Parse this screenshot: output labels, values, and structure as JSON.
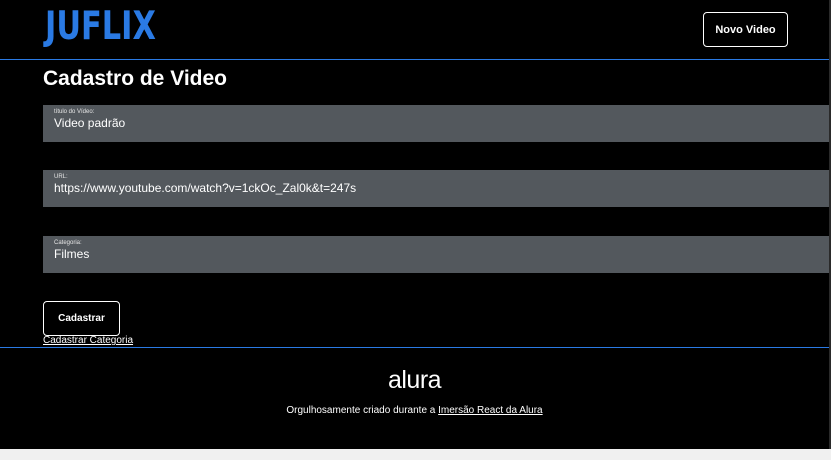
{
  "header": {
    "logo": "JUFLIX",
    "new_video_label": "Novo Video"
  },
  "form": {
    "title": "Cadastro de Video",
    "fields": [
      {
        "label": "título do Vídeo:",
        "value": "Video padrão"
      },
      {
        "label": "URL:",
        "value": "https://www.youtube.com/watch?v=1ckOc_Zal0k&t=247s"
      },
      {
        "label": "Categoria:",
        "value": "Filmes"
      }
    ],
    "submit_label": "Cadastrar",
    "category_link": "Cadastrar Categoria"
  },
  "footer": {
    "brand": "alura",
    "text_prefix": "Orgulhosamente criado durante a ",
    "link_text": "Imersão React da Alura"
  },
  "colors": {
    "accent": "#2a7ae4",
    "field_bg": "#53585d",
    "background": "#000000"
  }
}
